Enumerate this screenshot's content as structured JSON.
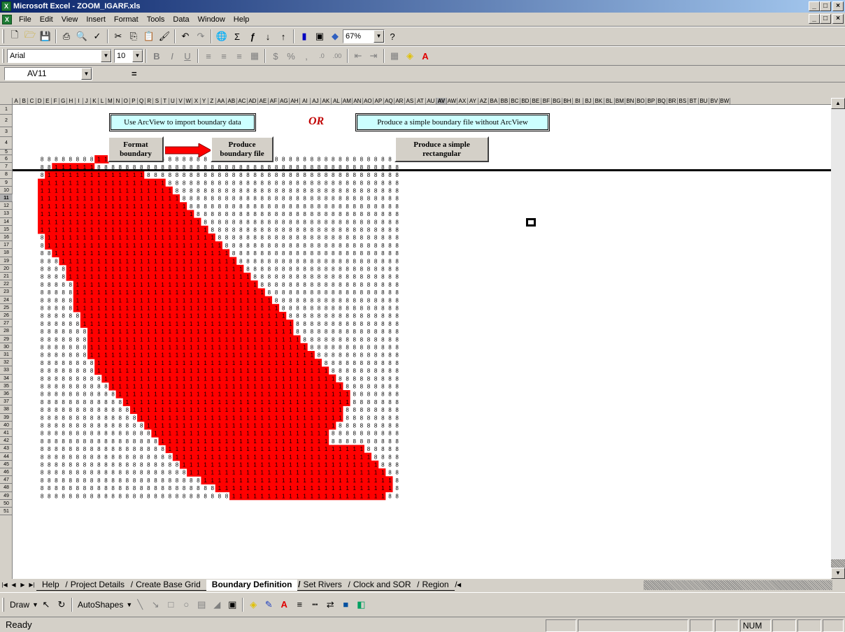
{
  "window": {
    "title": "Microsoft Excel - ZOOM_IGARF.xls",
    "app_icon_label": "X",
    "min": "_",
    "max": "□",
    "close": "×"
  },
  "menu": [
    "File",
    "Edit",
    "View",
    "Insert",
    "Format",
    "Tools",
    "Data",
    "Window",
    "Help"
  ],
  "toolbar": {
    "zoom": "67%",
    "font": "Arial",
    "size": "10"
  },
  "formula": {
    "namebox": "AV11",
    "eq": "="
  },
  "columns": [
    "A",
    "B",
    "C",
    "D",
    "E",
    "F",
    "G",
    "H",
    "I",
    "J",
    "K",
    "L",
    "M",
    "N",
    "O",
    "P",
    "Q",
    "R",
    "S",
    "T",
    "U",
    "V",
    "W",
    "X",
    "Y",
    "Z",
    "AA",
    "AB",
    "AC",
    "AD",
    "AE",
    "AF",
    "AG",
    "AH",
    "AI",
    "AJ",
    "AK",
    "AL",
    "AM",
    "AN",
    "AO",
    "AP",
    "AQ",
    "AR",
    "AS",
    "AT",
    "AU",
    "AV",
    "AW",
    "AX",
    "AY",
    "AZ",
    "BA",
    "BB",
    "BC",
    "BD",
    "BE",
    "BF",
    "BG",
    "BH",
    "BI",
    "BJ",
    "BK",
    "BL",
    "BM",
    "BN",
    "BO",
    "BP",
    "BQ",
    "BR",
    "BS",
    "BT",
    "BU",
    "BV",
    "BW"
  ],
  "sheet": {
    "box1": "Use ArcView to import boundary data",
    "or": "OR",
    "box2": "Produce a simple boundary file without ArcView",
    "btn_format": "Format boundary",
    "btn_produce": "Produce boundary file",
    "btn_rect": "Produce a simple rectangular",
    "grid": {
      "cols": 51,
      "row_start": 6,
      "row_end": 49,
      "outside": "8",
      "inside": "1",
      "color": "#ff0000",
      "red_ranges": [
        [
          9,
          10
        ],
        [
          3,
          8
        ],
        [
          2,
          15
        ],
        [
          1,
          18
        ],
        [
          1,
          19
        ],
        [
          1,
          20
        ],
        [
          1,
          21
        ],
        [
          1,
          22
        ],
        [
          1,
          23
        ],
        [
          1,
          24
        ],
        [
          2,
          25
        ],
        [
          2,
          26
        ],
        [
          3,
          27
        ],
        [
          4,
          28
        ],
        [
          5,
          29
        ],
        [
          5,
          30
        ],
        [
          6,
          31
        ],
        [
          6,
          32
        ],
        [
          6,
          33
        ],
        [
          6,
          34
        ],
        [
          7,
          35
        ],
        [
          7,
          36
        ],
        [
          8,
          36
        ],
        [
          8,
          37
        ],
        [
          8,
          38
        ],
        [
          8,
          39
        ],
        [
          9,
          40
        ],
        [
          9,
          41
        ],
        [
          10,
          42
        ],
        [
          11,
          43
        ],
        [
          12,
          44
        ],
        [
          13,
          44
        ],
        [
          14,
          43
        ],
        [
          15,
          43
        ],
        [
          16,
          42
        ],
        [
          17,
          41
        ],
        [
          18,
          41
        ],
        [
          19,
          46
        ],
        [
          20,
          47
        ],
        [
          21,
          48
        ],
        [
          22,
          49
        ],
        [
          24,
          50
        ],
        [
          26,
          50
        ],
        [
          28,
          49
        ],
        [
          30,
          48
        ],
        [
          32,
          44
        ],
        [
          34,
          39
        ]
      ]
    }
  },
  "rows": [
    1,
    2,
    3,
    4,
    5,
    6,
    7,
    8,
    9,
    10,
    11,
    12,
    13,
    14,
    15,
    16,
    17,
    18,
    19,
    20,
    21,
    22,
    23,
    24,
    25,
    26,
    27,
    28,
    29,
    30,
    31,
    32,
    33,
    34,
    35,
    36,
    37,
    38,
    39,
    40,
    41,
    42,
    43,
    44,
    45,
    46,
    47,
    48,
    49,
    50,
    51
  ],
  "tabs": [
    "Help",
    "Project Details",
    "Create Base Grid",
    "Boundary Definition",
    "Set Rivers",
    "Clock and SOR",
    "Region"
  ],
  "active_tab": "Boundary Definition",
  "draw": {
    "draw": "Draw",
    "autoshapes": "AutoShapes"
  },
  "status": {
    "left": "Ready",
    "num": "NUM"
  }
}
